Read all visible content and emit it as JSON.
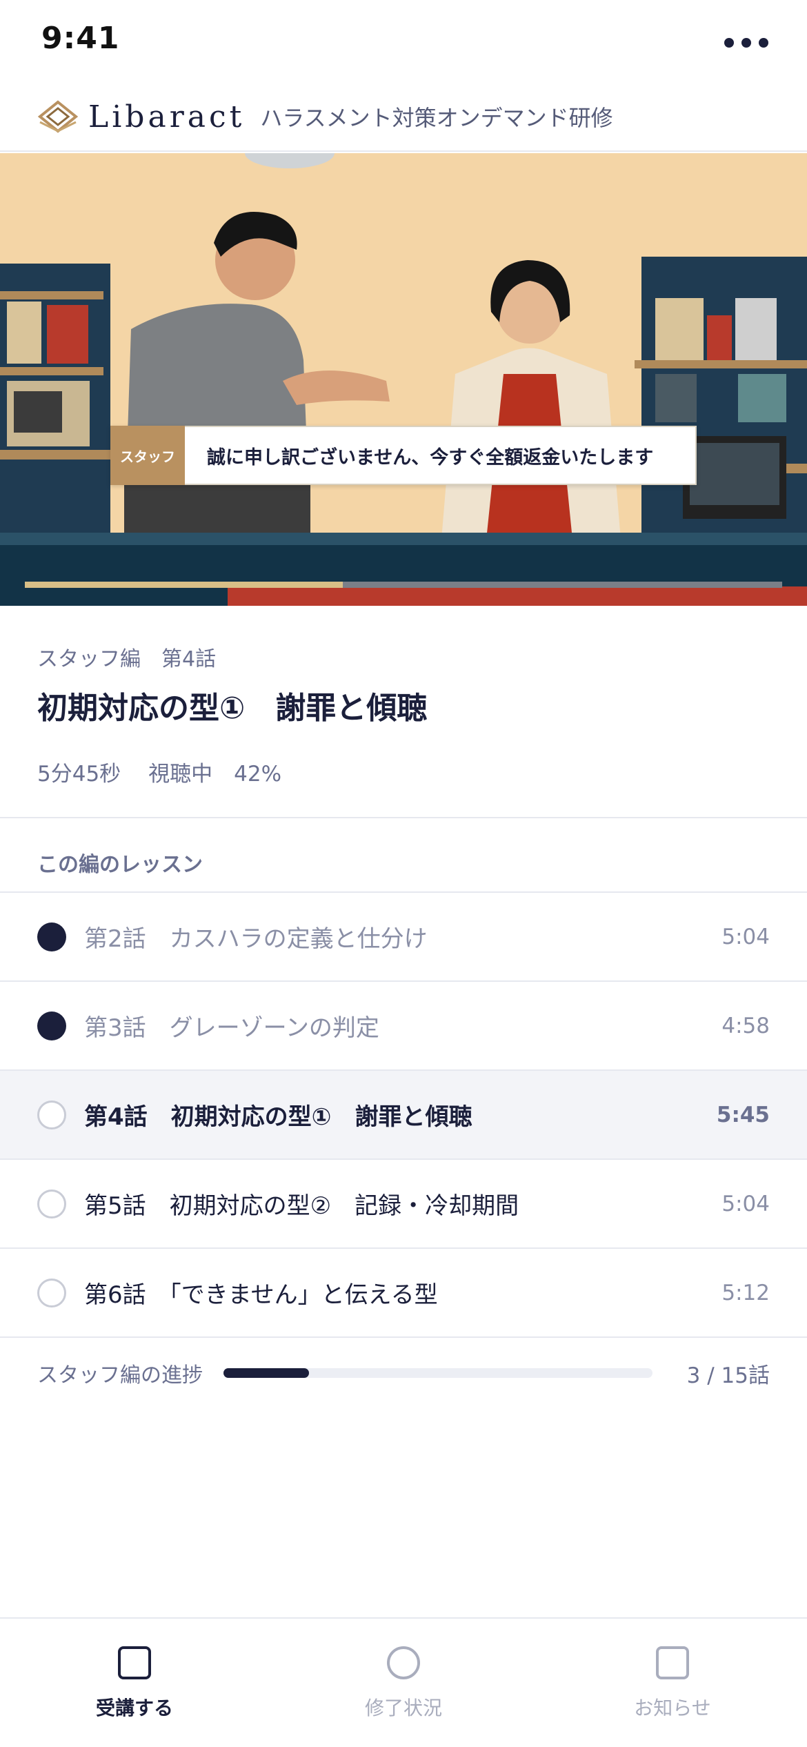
{
  "status_bar": {
    "time": "9:41"
  },
  "header": {
    "brand": "Libaract",
    "subtitle": "ハラスメント対策オンデマンド研修",
    "menu_icon": "more-dots-icon"
  },
  "video": {
    "subtitle_speaker": "スタッフ",
    "subtitle_text": "誠に申し訳ございません、今すぐ全額返金いたします",
    "playback_progress": 0.42
  },
  "lesson": {
    "series": "スタッフ編　第4話",
    "title": "初期対応の型①　謝罪と傾聴",
    "duration": "5分45秒",
    "status": "視聴中",
    "percent": "42%"
  },
  "lesson_list": {
    "heading": "この編のレッスン",
    "items": [
      {
        "title": "第2話　カスハラの定義と仕分け",
        "duration": "5:04",
        "state": "completed"
      },
      {
        "title": "第3話　グレーゾーンの判定",
        "duration": "4:58",
        "state": "completed"
      },
      {
        "title": "第4話　初期対応の型①　謝罪と傾聴",
        "duration": "5:45",
        "state": "current"
      },
      {
        "title": "第5話　初期対応の型②　記録・冷却期間",
        "duration": "5:04",
        "state": "upcoming"
      },
      {
        "title": "第6話　「できません」と伝える型",
        "duration": "5:12",
        "state": "upcoming"
      }
    ]
  },
  "course_progress": {
    "label": "スタッフ編の進捗",
    "count": "3 / 15話",
    "fraction": 0.2
  },
  "tabs": [
    {
      "label": "受講する",
      "icon": "square-icon",
      "active": true
    },
    {
      "label": "修了状況",
      "icon": "circle-icon",
      "active": false
    },
    {
      "label": "お知らせ",
      "icon": "square-icon",
      "active": false
    }
  ],
  "colors": {
    "navy": "#1b1f3b",
    "muted": "#6a7090",
    "brand_gold": "#b99160",
    "divider": "#e6e8ef"
  }
}
